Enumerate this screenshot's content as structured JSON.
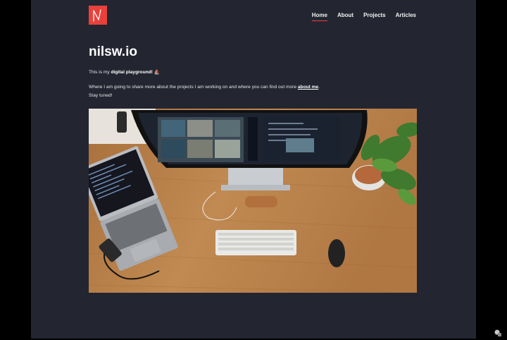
{
  "header": {
    "logo_icon": "red-square-nw-logo",
    "nav": [
      {
        "label": "Home",
        "active": true
      },
      {
        "label": "About",
        "active": false
      },
      {
        "label": "Projects",
        "active": false
      },
      {
        "label": "Articles",
        "active": false
      }
    ]
  },
  "main": {
    "title": "nilsw.io",
    "intro_prefix": "This is my ",
    "intro_bold": "digital playground!",
    "intro_emoji": "⛵",
    "para_text": "Where I am going to share more about the projects I am working on and where you can find out more ",
    "para_link": "about me",
    "para_end": ".",
    "stay": "Stay tuned!",
    "hero_image": "desk-setup-photo"
  },
  "footer": {
    "corner_icon": "chat-bubble-icon"
  },
  "colors": {
    "accent": "#e8413b",
    "background": "#232631",
    "outer": "#000000"
  }
}
